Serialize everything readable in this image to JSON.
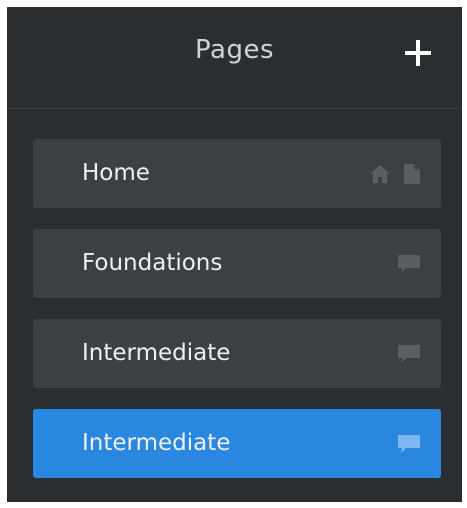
{
  "header": {
    "title": "Pages",
    "add_icon": "plus-icon"
  },
  "pages": [
    {
      "label": "Home",
      "icons": [
        "home-icon",
        "page-icon"
      ],
      "active": false
    },
    {
      "label": "Foundations",
      "icons": [
        "comment-icon"
      ],
      "active": false
    },
    {
      "label": "Intermediate",
      "icons": [
        "comment-icon"
      ],
      "active": false
    },
    {
      "label": "Intermediate",
      "icons": [
        "comment-icon"
      ],
      "active": true
    }
  ],
  "colors": {
    "panel_bg": "#2b2e31",
    "item_bg": "#3c3f43",
    "active_bg": "#2a87e0",
    "text": "#eef0f2",
    "icon_muted": "#5a5e63",
    "icon_active": "#7fb6ee"
  }
}
